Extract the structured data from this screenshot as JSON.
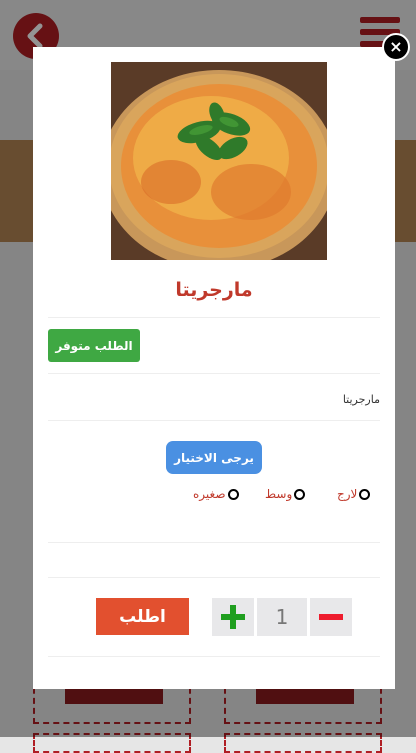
{
  "modal": {
    "product_title": "مارجريتا",
    "status_label": "الطلب متوفر",
    "description": "مارجريتا",
    "choose_label": "يرجى الاختيار",
    "size_options": [
      "لارج",
      "وسط",
      "صغيره"
    ],
    "quantity": "1",
    "order_label": "اطلب",
    "close_symbol": "×"
  },
  "colors": {
    "brand": "#b01e24",
    "title": "#c0392b",
    "status": "#3fa843",
    "choose": "#4a90e2",
    "order": "#e2502f",
    "plus": "#1f9e1f",
    "minus": "#ee1c2e"
  }
}
